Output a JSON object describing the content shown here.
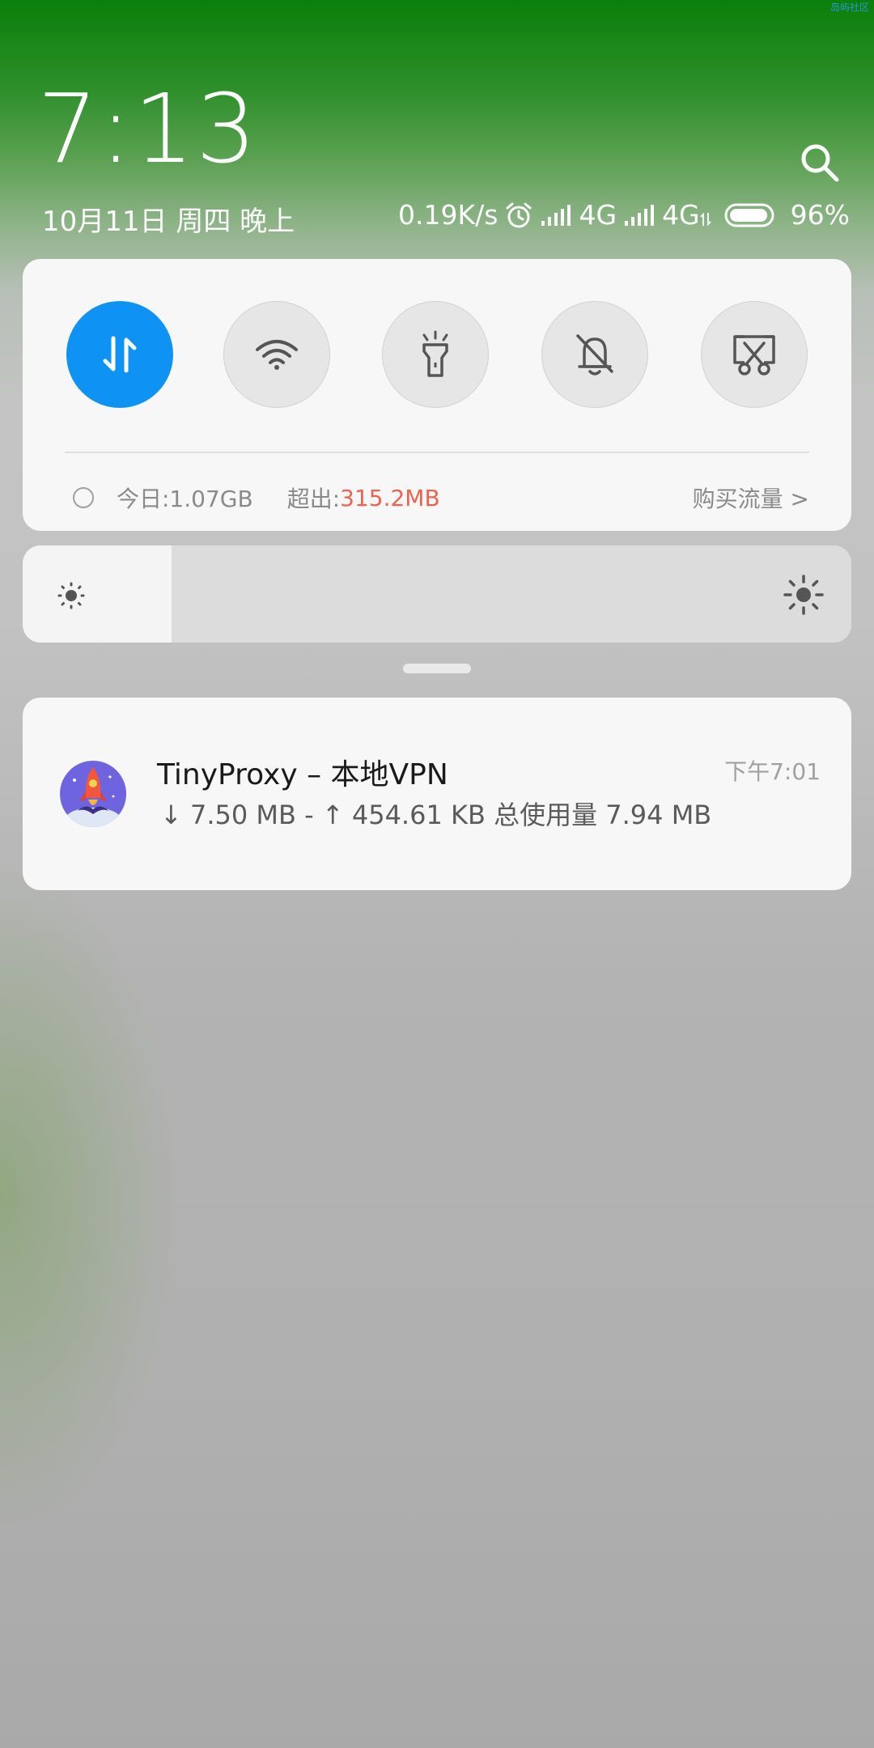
{
  "watermark": "岛屿社区",
  "lockscreen": {
    "time": "7:13",
    "date": "10月11日 周四 晚上"
  },
  "status_bar": {
    "net_speed": "0.19K/s",
    "sim1_type": "4G",
    "sim2_type": "4G",
    "battery_percent": "96%",
    "battery_level": 0.96,
    "icons": [
      "alarm-icon",
      "signal-icon",
      "signal-icon",
      "data-activity-icon",
      "battery-icon",
      "search-icon"
    ]
  },
  "quick_settings": {
    "toggles": [
      {
        "name": "mobile-data",
        "icon": "data-arrows-icon",
        "active": true
      },
      {
        "name": "wifi",
        "icon": "wifi-icon",
        "active": false
      },
      {
        "name": "flashlight",
        "icon": "flashlight-icon",
        "active": false
      },
      {
        "name": "mute",
        "icon": "bell-off-icon",
        "active": false
      },
      {
        "name": "screenshot",
        "icon": "scissors-screenshot-icon",
        "active": false
      }
    ],
    "usage": {
      "today_label": "今日:1.07GB",
      "over_label": "超出:",
      "over_value": "315.2MB",
      "buy_label": "购买流量 >"
    },
    "accent_color": "#0e93f4",
    "over_color": "#f0624f"
  },
  "brightness": {
    "level": 0.18,
    "icons": [
      "brightness-low-icon",
      "brightness-high-icon"
    ]
  },
  "notification": {
    "title": "TinyProxy – 本地VPN",
    "time": "下午7:01",
    "text": "↓ 7.50 MB - ↑ 454.61 KB 总使用量 7.94 MB",
    "icon": "rocket-app-icon"
  }
}
